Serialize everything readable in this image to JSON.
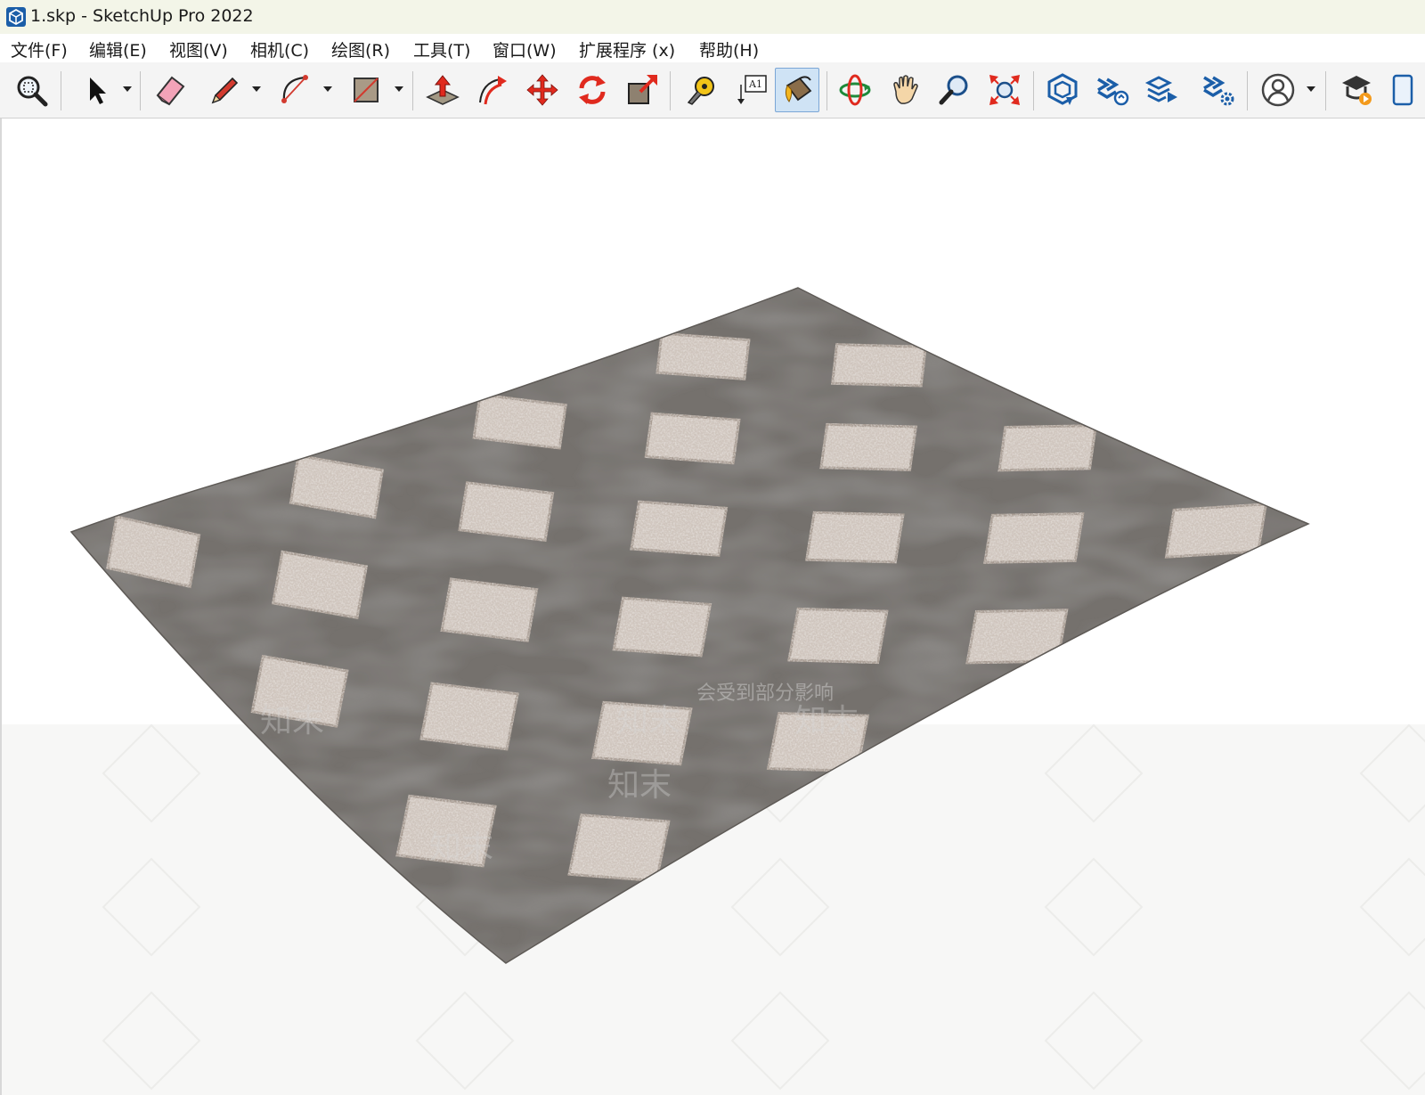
{
  "window": {
    "title": "1.skp - SketchUp Pro 2022",
    "app_icon": "sketchup-icon"
  },
  "menu": {
    "items": [
      "文件(F)",
      "编辑(E)",
      "视图(V)",
      "相机(C)",
      "绘图(R)",
      "工具(T)",
      "窗口(W)",
      "扩展程序 (x)",
      "帮助(H)"
    ]
  },
  "toolbar": {
    "tools": [
      {
        "name": "zoom-window",
        "icon": "zoom-window-icon"
      },
      {
        "name": "select",
        "icon": "select-arrow-icon"
      },
      {
        "name": "eraser",
        "icon": "eraser-icon"
      },
      {
        "name": "line",
        "icon": "pencil-icon"
      },
      {
        "name": "arc",
        "icon": "arc-icon"
      },
      {
        "name": "rectangle",
        "icon": "rectangle-icon"
      },
      {
        "name": "push-pull",
        "icon": "push-pull-icon"
      },
      {
        "name": "offset",
        "icon": "offset-icon"
      },
      {
        "name": "move",
        "icon": "move-icon"
      },
      {
        "name": "rotate",
        "icon": "rotate-icon"
      },
      {
        "name": "scale",
        "icon": "scale-icon"
      },
      {
        "name": "tape-measure",
        "icon": "tape-measure-icon"
      },
      {
        "name": "text",
        "icon": "text-icon",
        "label": "A1"
      },
      {
        "name": "paint-bucket",
        "icon": "paint-bucket-icon",
        "active": true
      },
      {
        "name": "orbit",
        "icon": "orbit-icon"
      },
      {
        "name": "pan",
        "icon": "pan-hand-icon"
      },
      {
        "name": "zoom",
        "icon": "zoom-icon"
      },
      {
        "name": "zoom-extents",
        "icon": "zoom-extents-icon"
      },
      {
        "name": "3d-warehouse",
        "icon": "warehouse-icon"
      },
      {
        "name": "extension-warehouse",
        "icon": "extension-warehouse-icon"
      },
      {
        "name": "share-model",
        "icon": "share-model-icon"
      },
      {
        "name": "extension-manager",
        "icon": "extension-manager-icon"
      },
      {
        "name": "account",
        "icon": "user-account-icon"
      },
      {
        "name": "learn",
        "icon": "learn-icon"
      }
    ]
  },
  "viewport": {
    "background": "#ffffff",
    "model": "diamond-pattern rug",
    "colors": {
      "dark_fabric": "#75716d",
      "shag_light": "#cfc5bd",
      "shag_shadow": "#a89c93"
    },
    "watermark_text": "知末",
    "overlay_text": "会受到部分影响"
  }
}
